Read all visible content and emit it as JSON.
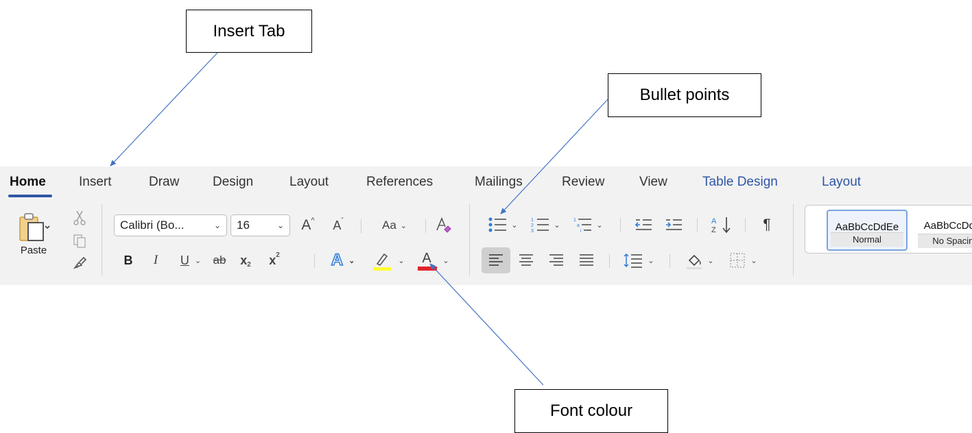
{
  "callouts": {
    "insert_tab": "Insert Tab",
    "bullet_points": "Bullet points",
    "font_colour": "Font colour"
  },
  "ribbon": {
    "tabs": [
      {
        "label": "Home",
        "active": true
      },
      {
        "label": "Insert"
      },
      {
        "label": "Draw"
      },
      {
        "label": "Design"
      },
      {
        "label": "Layout"
      },
      {
        "label": "References"
      },
      {
        "label": "Mailings"
      },
      {
        "label": "Review"
      },
      {
        "label": "View"
      },
      {
        "label": "Table Design",
        "contextual": true
      },
      {
        "label": "Layout",
        "contextual": true
      }
    ],
    "clipboard": {
      "paste_label": "Paste",
      "paste_icon": "clipboard-icon",
      "cut_icon": "scissors-icon",
      "copy_icon": "copy-icon",
      "format_painter_icon": "paintbrush-icon"
    },
    "font": {
      "font_name": "Calibri (Bo...",
      "font_size": "16",
      "grow_label": "A",
      "shrink_label": "A",
      "change_case_label": "Aa",
      "bold": "B",
      "italic": "I",
      "underline": "U",
      "strikethrough": "ab",
      "subscript_base": "x",
      "subscript_mark": "2",
      "superscript_base": "x",
      "superscript_mark": "2",
      "text_effects": "A",
      "font_color_label": "A"
    },
    "paragraph": {
      "show_hide_symbol": "¶"
    },
    "styles": [
      {
        "sample": "AaBbCcDdEe",
        "name": "Normal",
        "selected": true
      },
      {
        "sample": "AaBbCcDdEe",
        "name": "No Spacing"
      }
    ]
  },
  "colors": {
    "accent": "#2f56a6",
    "highlight": "#ffff33",
    "font_color": "#e0262c",
    "arrow": "#4472c4"
  }
}
